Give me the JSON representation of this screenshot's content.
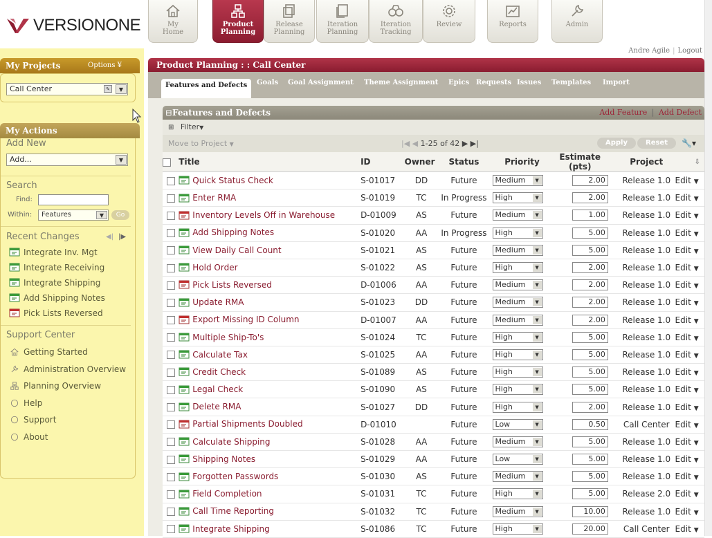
{
  "logo_text": "VERSIONONE",
  "nav_tabs": [
    {
      "label": "My Home",
      "icon": "home-icon"
    },
    {
      "label": "Product Planning",
      "icon": "product-planning-icon"
    },
    {
      "label": "Release Planning",
      "icon": "release-planning-icon"
    },
    {
      "label": "Iteration Planning",
      "icon": "iteration-planning-icon"
    },
    {
      "label": "Iteration Tracking",
      "icon": "iteration-tracking-icon"
    },
    {
      "label": "Review",
      "icon": "gear-icon"
    },
    {
      "label": "Reports",
      "icon": "chart-icon"
    },
    {
      "label": "Admin",
      "icon": "wrench-icon"
    }
  ],
  "active_tab": "Product Planning",
  "user": {
    "name": "Andre Agile",
    "sep": "|",
    "logout": "Logout"
  },
  "sidebar": {
    "projects_title": "My Projects",
    "options_label": "Options ¥",
    "project_value": "Call Center",
    "actions_title": "My Actions",
    "add_new_label": "Add New",
    "add_value": "Add...",
    "search_label": "Search",
    "find_label": "Find:",
    "within_label": "Within:",
    "within_value": "Features",
    "go_label": "Go",
    "recent_label": "Recent Changes",
    "recent": [
      "Integrate Inv. Mgt",
      "Integrate Receiving",
      "Integrate Shipping",
      "Add Shipping Notes",
      "Pick Lists Reversed"
    ],
    "support_label": "Support Center",
    "support_items": [
      "Getting Started",
      "Administration Overview",
      "Planning Overview",
      "Help",
      "Support",
      "About"
    ]
  },
  "main": {
    "title": "Product Planning : : Call Center",
    "subtabs": [
      "Features and Defects",
      "Goals",
      "Goal Assignment",
      "Theme Assignment",
      "Epics",
      "Requests",
      "Issues",
      "Templates",
      "Import"
    ],
    "grid_title": "Features and Defects",
    "add_feature": "Add Feature",
    "add_defect": "Add Defect",
    "link_sep": "|",
    "filter_label": "Filter",
    "move_label": "Move to Project",
    "pager": "1-25 of 42",
    "apply": "Apply",
    "reset": "Reset"
  },
  "columns": [
    "Title",
    "ID",
    "Owner",
    "Status",
    "Priority",
    "Estimate (pts)",
    "Project"
  ],
  "edit_label": "Edit",
  "rows": [
    {
      "type": "feature",
      "title": "Quick Status Check",
      "id": "S-01017",
      "owner": "DD",
      "status": "Future",
      "priority": "Medium",
      "estimate": "2.00",
      "project": "Release 1.0"
    },
    {
      "type": "feature",
      "title": "Enter RMA",
      "id": "S-01019",
      "owner": "TC",
      "status": "In Progress",
      "priority": "High",
      "estimate": "2.00",
      "project": "Release 1.0"
    },
    {
      "type": "defect",
      "title": "Inventory Levels Off in Warehouse",
      "id": "D-01009",
      "owner": "AS",
      "status": "Future",
      "priority": "Medium",
      "estimate": "1.00",
      "project": "Release 1.0"
    },
    {
      "type": "feature",
      "title": "Add Shipping Notes",
      "id": "S-01020",
      "owner": "AA",
      "status": "In Progress",
      "priority": "High",
      "estimate": "5.00",
      "project": "Release 1.0"
    },
    {
      "type": "feature",
      "title": "View Daily Call Count",
      "id": "S-01021",
      "owner": "AS",
      "status": "Future",
      "priority": "Medium",
      "estimate": "5.00",
      "project": "Release 1.0"
    },
    {
      "type": "feature",
      "title": "Hold Order",
      "id": "S-01022",
      "owner": "AS",
      "status": "Future",
      "priority": "High",
      "estimate": "2.00",
      "project": "Release 1.0"
    },
    {
      "type": "defect",
      "title": "Pick Lists Reversed",
      "id": "D-01006",
      "owner": "AA",
      "status": "Future",
      "priority": "Medium",
      "estimate": "2.00",
      "project": "Release 1.0"
    },
    {
      "type": "feature",
      "title": "Update RMA",
      "id": "S-01023",
      "owner": "DD",
      "status": "Future",
      "priority": "Medium",
      "estimate": "2.00",
      "project": "Release 1.0"
    },
    {
      "type": "defect",
      "title": "Export Missing ID Column",
      "id": "D-01007",
      "owner": "AA",
      "status": "Future",
      "priority": "Medium",
      "estimate": "2.00",
      "project": "Release 1.0"
    },
    {
      "type": "feature",
      "title": "Multiple Ship-To's",
      "id": "S-01024",
      "owner": "TC",
      "status": "Future",
      "priority": "High",
      "estimate": "5.00",
      "project": "Release 1.0"
    },
    {
      "type": "feature",
      "title": "Calculate Tax",
      "id": "S-01025",
      "owner": "AA",
      "status": "Future",
      "priority": "High",
      "estimate": "5.00",
      "project": "Release 1.0"
    },
    {
      "type": "feature",
      "title": "Credit Check",
      "id": "S-01089",
      "owner": "AS",
      "status": "Future",
      "priority": "High",
      "estimate": "5.00",
      "project": "Release 1.0"
    },
    {
      "type": "feature",
      "title": "Legal Check",
      "id": "S-01090",
      "owner": "AS",
      "status": "Future",
      "priority": "High",
      "estimate": "5.00",
      "project": "Release 1.0"
    },
    {
      "type": "feature",
      "title": "Delete RMA",
      "id": "S-01027",
      "owner": "DD",
      "status": "Future",
      "priority": "High",
      "estimate": "2.00",
      "project": "Release 1.0"
    },
    {
      "type": "defect",
      "title": "Partial Shipments Doubled",
      "id": "D-01010",
      "owner": "",
      "status": "Future",
      "priority": "Low",
      "estimate": "0.50",
      "project": "Call Center"
    },
    {
      "type": "feature",
      "title": "Calculate Shipping",
      "id": "S-01028",
      "owner": "AA",
      "status": "Future",
      "priority": "Medium",
      "estimate": "5.00",
      "project": "Release 1.0"
    },
    {
      "type": "feature",
      "title": "Shipping Notes",
      "id": "S-01029",
      "owner": "AA",
      "status": "Future",
      "priority": "Low",
      "estimate": "5.00",
      "project": "Release 1.0"
    },
    {
      "type": "feature",
      "title": "Forgotten Passwords",
      "id": "S-01030",
      "owner": "AS",
      "status": "Future",
      "priority": "Medium",
      "estimate": "5.00",
      "project": "Release 1.0"
    },
    {
      "type": "feature",
      "title": "Field Completion",
      "id": "S-01031",
      "owner": "TC",
      "status": "Future",
      "priority": "High",
      "estimate": "5.00",
      "project": "Release 2.0"
    },
    {
      "type": "feature",
      "title": "Call Time Reporting",
      "id": "S-01032",
      "owner": "TC",
      "status": "Future",
      "priority": "Medium",
      "estimate": "10.00",
      "project": "Release 1.0"
    },
    {
      "type": "feature",
      "title": "Integrate Shipping",
      "id": "S-01086",
      "owner": "TC",
      "status": "Future",
      "priority": "High",
      "estimate": "20.00",
      "project": "Call Center"
    }
  ],
  "colors": {
    "accent": "#9c2236",
    "sidebar_bg": "#fbf6ad",
    "sidebar_header": "#b8861f",
    "feature_icon": "#3a9a3a",
    "defect_icon": "#c03030"
  }
}
